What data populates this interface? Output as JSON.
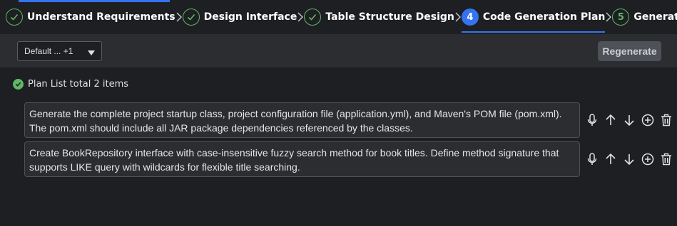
{
  "stepper": {
    "steps": [
      {
        "label": "Understand Requirements",
        "state": "done"
      },
      {
        "label": "Design Interface",
        "state": "done"
      },
      {
        "label": "Table Structure Design",
        "state": "done"
      },
      {
        "label": "Code Generation Plan",
        "state": "active",
        "number": "4"
      },
      {
        "label": "Generate S",
        "state": "todo",
        "number": "5"
      }
    ]
  },
  "toolbar": {
    "dropdown_value": "Default ...  +1",
    "regenerate_label": "Regenerate"
  },
  "plan": {
    "summary": "Plan List total 2 items",
    "items": [
      {
        "text": "Generate the complete project startup class, project configuration file (application.yml), and Maven's POM file (pom.xml). The pom.xml should include all JAR package dependencies referenced by the classes."
      },
      {
        "text": "Create BookRepository interface with case-insensitive fuzzy search method for book titles. Define method signature that supports LIKE query with wildcards for flexible title searching."
      }
    ],
    "item_actions": [
      "microphone-icon",
      "arrow-up-icon",
      "arrow-down-icon",
      "add-circle-icon",
      "trash-icon"
    ]
  },
  "colors": {
    "accent": "#3574f0",
    "success": "#5fb865",
    "background": "#1e1f22",
    "panel": "#2b2d30"
  }
}
